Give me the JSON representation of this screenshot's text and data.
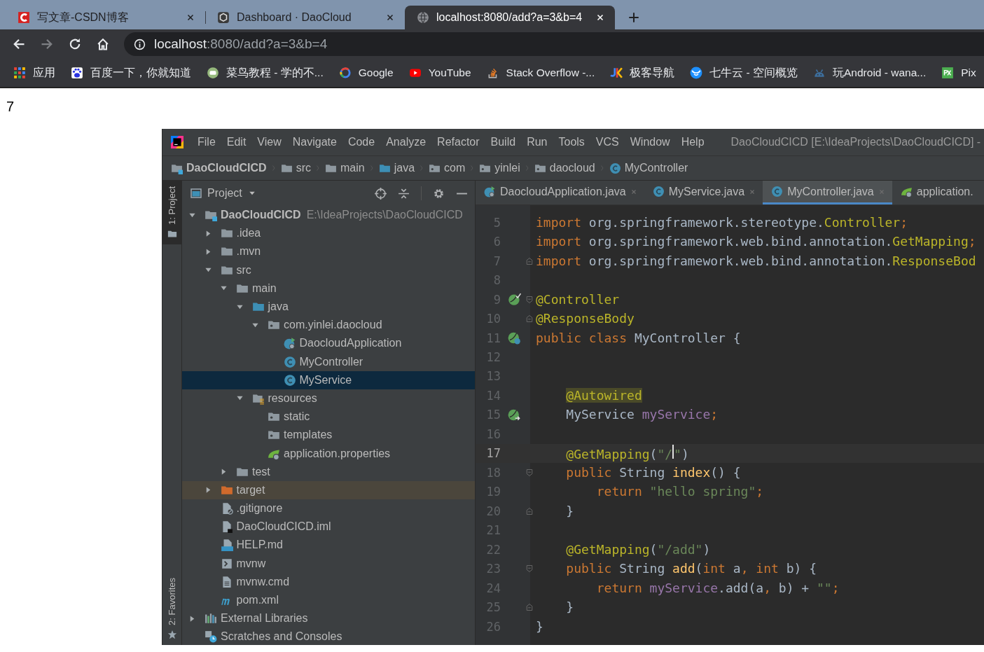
{
  "browser": {
    "tabs": [
      {
        "title": "写文章-CSDN博客",
        "selected": false
      },
      {
        "title": "Dashboard · DaoCloud",
        "selected": false
      },
      {
        "title": "localhost:8080/add?a=3&b=4",
        "selected": true
      }
    ],
    "nav": [
      {
        "kind": "back",
        "disabled": false
      },
      {
        "kind": "forward",
        "disabled": true
      },
      {
        "kind": "reload",
        "disabled": false
      },
      {
        "kind": "home",
        "disabled": false
      }
    ],
    "address": {
      "host": "localhost",
      "rest": ":8080/add?a=3&b=4"
    },
    "bookmarks": [
      {
        "label": "应用"
      },
      {
        "label": "百度一下，你就知道"
      },
      {
        "label": "菜鸟教程 - 学的不..."
      },
      {
        "label": "Google"
      },
      {
        "label": "YouTube"
      },
      {
        "label": "Stack Overflow -..."
      },
      {
        "label": "极客导航"
      },
      {
        "label": "七牛云 - 空间概览"
      },
      {
        "label": "玩Android - wana..."
      },
      {
        "label": "Pix"
      }
    ]
  },
  "page": {
    "text": "7"
  },
  "ide": {
    "menu": [
      "File",
      "Edit",
      "View",
      "Navigate",
      "Code",
      "Analyze",
      "Refactor",
      "Build",
      "Run",
      "Tools",
      "VCS",
      "Window",
      "Help"
    ],
    "title": "DaoCloudCICD [E:\\IdeaProjects\\DaoCloudCICD] -",
    "breadcrumbs": [
      {
        "label": "DaoCloudCICD",
        "kind": "module"
      },
      {
        "label": "src",
        "kind": "folder"
      },
      {
        "label": "main",
        "kind": "folder"
      },
      {
        "label": "java",
        "kind": "src"
      },
      {
        "label": "com",
        "kind": "package"
      },
      {
        "label": "yinlei",
        "kind": "package"
      },
      {
        "label": "daocloud",
        "kind": "package"
      },
      {
        "label": "MyController",
        "kind": "class"
      }
    ],
    "stripe_top": [
      {
        "label": "1: Project",
        "selected": true
      }
    ],
    "stripe_bottom": [
      {
        "label": "2: Favorites",
        "selected": false
      }
    ],
    "panel_title": "Project",
    "tree": [
      {
        "label": "DaoCloudCICD",
        "path": "E:\\IdeaProjects\\DaoCloudCICD",
        "kind": "module",
        "expanded": true,
        "selected": false,
        "highlighted": false,
        "children": [
          {
            "label": ".idea",
            "kind": "folder",
            "expanded": false,
            "selected": false,
            "highlighted": false
          },
          {
            "label": ".mvn",
            "kind": "folder",
            "expanded": false,
            "selected": false,
            "highlighted": false
          },
          {
            "label": "src",
            "kind": "folder",
            "expanded": true,
            "selected": false,
            "highlighted": false,
            "children": [
              {
                "label": "main",
                "kind": "folder",
                "expanded": true,
                "selected": false,
                "highlighted": false,
                "children": [
                  {
                    "label": "java",
                    "kind": "src",
                    "expanded": true,
                    "selected": false,
                    "highlighted": false,
                    "children": [
                      {
                        "label": "com.yinlei.daocloud",
                        "kind": "package",
                        "expanded": true,
                        "selected": false,
                        "highlighted": false,
                        "children": [
                          {
                            "label": "DaocloudApplication",
                            "kind": "appclass",
                            "selected": false,
                            "highlighted": false
                          },
                          {
                            "label": "MyController",
                            "kind": "class",
                            "selected": false,
                            "highlighted": false
                          },
                          {
                            "label": "MyService",
                            "kind": "class",
                            "selected": true,
                            "highlighted": false
                          }
                        ]
                      }
                    ]
                  },
                  {
                    "label": "resources",
                    "kind": "resources",
                    "expanded": true,
                    "selected": false,
                    "highlighted": false,
                    "children": [
                      {
                        "label": "static",
                        "kind": "package",
                        "selected": false,
                        "highlighted": false
                      },
                      {
                        "label": "templates",
                        "kind": "package",
                        "selected": false,
                        "highlighted": false
                      },
                      {
                        "label": "application.properties",
                        "kind": "spring",
                        "selected": false,
                        "highlighted": false
                      }
                    ]
                  }
                ]
              },
              {
                "label": "test",
                "kind": "folder",
                "expanded": false,
                "selected": false,
                "highlighted": false
              }
            ]
          },
          {
            "label": "target",
            "kind": "excluded",
            "expanded": false,
            "selected": false,
            "highlighted": true
          },
          {
            "label": ".gitignore",
            "kind": "gitignore",
            "selected": false,
            "highlighted": false
          },
          {
            "label": "DaoCloudCICD.iml",
            "kind": "iml",
            "selected": false,
            "highlighted": false
          },
          {
            "label": "HELP.md",
            "kind": "md",
            "selected": false,
            "highlighted": false
          },
          {
            "label": "mvnw",
            "kind": "script",
            "selected": false,
            "highlighted": false
          },
          {
            "label": "mvnw.cmd",
            "kind": "cmd",
            "selected": false,
            "highlighted": false
          },
          {
            "label": "pom.xml",
            "kind": "maven",
            "selected": false,
            "highlighted": false
          }
        ]
      },
      {
        "label": "External Libraries",
        "kind": "libraries",
        "expanded": false,
        "selected": false,
        "highlighted": false
      },
      {
        "label": "Scratches and Consoles",
        "kind": "scratches",
        "selected": false,
        "highlighted": false
      }
    ],
    "editor_tabs": [
      {
        "label": "DaocloudApplication.java",
        "kind": "appclass",
        "selected": false,
        "closable": true
      },
      {
        "label": "MyService.java",
        "kind": "class",
        "selected": false,
        "closable": true
      },
      {
        "label": "MyController.java",
        "kind": "class",
        "selected": true,
        "closable": true
      },
      {
        "label": "application.",
        "kind": "spring",
        "selected": false,
        "closable": false
      }
    ],
    "code": [
      {
        "number": "5",
        "current": false,
        "tokens": [
          {
            "kind": "kw",
            "t": "import "
          },
          {
            "kind": "id",
            "t": "org.springframework.stereotype."
          },
          {
            "kind": "ann",
            "t": "Controller"
          },
          {
            "kind": "kw",
            "t": ";"
          }
        ]
      },
      {
        "number": "6",
        "current": false,
        "tokens": [
          {
            "kind": "kw",
            "t": "import "
          },
          {
            "kind": "id",
            "t": "org.springframework.web.bind.annotation."
          },
          {
            "kind": "ann",
            "t": "GetMapping"
          },
          {
            "kind": "kw",
            "t": ";"
          }
        ]
      },
      {
        "number": "7",
        "current": false,
        "tokens": [
          {
            "kind": "kw",
            "t": "import "
          },
          {
            "kind": "id",
            "t": "org.springframework.web.bind.annotation."
          },
          {
            "kind": "ann",
            "t": "ResponseBod"
          }
        ]
      },
      {
        "number": "8",
        "current": false
      },
      {
        "number": "9",
        "current": false,
        "tokens": [
          {
            "kind": "ann",
            "t": "@Controller"
          }
        ]
      },
      {
        "number": "10",
        "current": false,
        "tokens": [
          {
            "kind": "ann",
            "t": "@ResponseBody"
          }
        ]
      },
      {
        "number": "11",
        "current": false,
        "tokens": [
          {
            "kind": "kw",
            "t": "public class "
          },
          {
            "kind": "id",
            "t": "MyController {"
          }
        ]
      },
      {
        "number": "12",
        "current": false
      },
      {
        "number": "13",
        "current": false
      },
      {
        "number": "14",
        "current": false,
        "tokens": [
          {
            "kind": "hl",
            "t": "    @Autowired"
          }
        ]
      },
      {
        "number": "15",
        "current": false,
        "tokens": [
          {
            "kind": "id",
            "t": "    MyService "
          },
          {
            "kind": "field",
            "t": "myService"
          },
          {
            "kind": "kw",
            "t": ";"
          }
        ]
      },
      {
        "number": "16",
        "current": false
      },
      {
        "number": "17",
        "current": true,
        "tokens": [
          {
            "kind": "ann",
            "t": "    @GetMapping"
          },
          {
            "kind": "id",
            "t": "("
          },
          {
            "kind": "str",
            "t": "\"/"
          },
          {
            "kind": "caret"
          },
          {
            "kind": "str",
            "t": "\""
          },
          {
            "kind": "id",
            "t": ")"
          }
        ]
      },
      {
        "number": "18",
        "current": false,
        "tokens": [
          {
            "kind": "kw",
            "t": "    public "
          },
          {
            "kind": "id",
            "t": "String "
          },
          {
            "kind": "fn",
            "t": "index"
          },
          {
            "kind": "id",
            "t": "() {"
          }
        ]
      },
      {
        "number": "19",
        "current": false,
        "tokens": [
          {
            "kind": "kw",
            "t": "        return "
          },
          {
            "kind": "str",
            "t": "\"hello spring\""
          },
          {
            "kind": "kw",
            "t": ";"
          }
        ]
      },
      {
        "number": "20",
        "current": false,
        "tokens": [
          {
            "kind": "id",
            "t": "    }"
          }
        ]
      },
      {
        "number": "21",
        "current": false
      },
      {
        "number": "22",
        "current": false,
        "tokens": [
          {
            "kind": "ann",
            "t": "    @GetMapping"
          },
          {
            "kind": "id",
            "t": "("
          },
          {
            "kind": "str",
            "t": "\"/add\""
          },
          {
            "kind": "id",
            "t": ")"
          }
        ]
      },
      {
        "number": "23",
        "current": false,
        "tokens": [
          {
            "kind": "kw",
            "t": "    public "
          },
          {
            "kind": "id",
            "t": "String "
          },
          {
            "kind": "fn",
            "t": "add"
          },
          {
            "kind": "id",
            "t": "("
          },
          {
            "kind": "kw",
            "t": "int "
          },
          {
            "kind": "id",
            "t": "a"
          },
          {
            "kind": "kw",
            "t": ", int "
          },
          {
            "kind": "id",
            "t": "b) {"
          }
        ]
      },
      {
        "number": "24",
        "current": false,
        "tokens": [
          {
            "kind": "kw",
            "t": "        return "
          },
          {
            "kind": "field",
            "t": "myService"
          },
          {
            "kind": "id",
            "t": ".add(a"
          },
          {
            "kind": "kw",
            "t": ", "
          },
          {
            "kind": "id",
            "t": "b) + "
          },
          {
            "kind": "str",
            "t": "\"\""
          },
          {
            "kind": "kw",
            "t": ";"
          }
        ]
      },
      {
        "number": "25",
        "current": false,
        "tokens": [
          {
            "kind": "id",
            "t": "    }"
          }
        ]
      },
      {
        "number": "26",
        "current": false,
        "tokens": [
          {
            "kind": "id",
            "t": "}"
          }
        ]
      }
    ]
  }
}
